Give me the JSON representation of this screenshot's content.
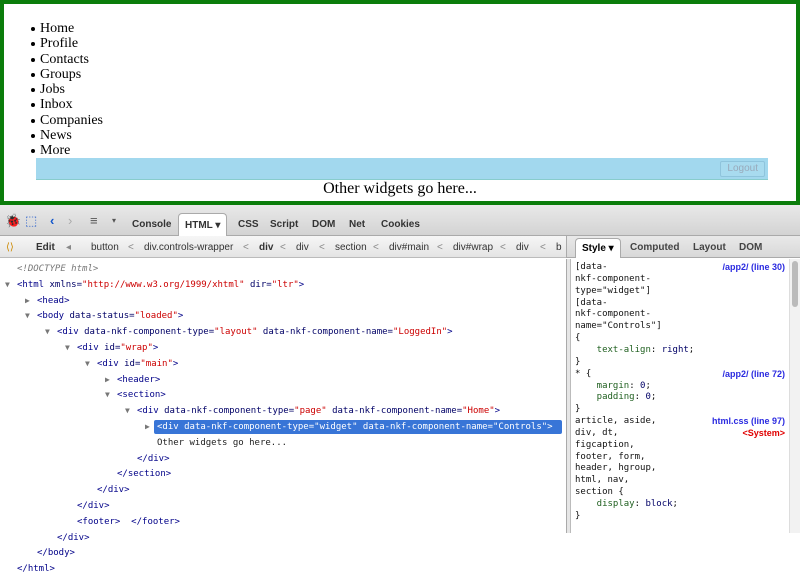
{
  "page": {
    "nav_items": [
      "Home",
      "Profile",
      "Contacts",
      "Groups",
      "Jobs",
      "Inbox",
      "Companies",
      "News",
      "More"
    ],
    "logout_label": "Logout",
    "other_widgets_text": "Other widgets go here...",
    "border_color": "#0b7d0b",
    "controls_bg": "#a2d8ee"
  },
  "devtools": {
    "tabs": [
      "Console",
      "HTML ▾",
      "CSS",
      "Script",
      "DOM",
      "Net",
      "Cookies"
    ],
    "active_tab": "HTML",
    "search_placeholder": "",
    "edit_label": "Edit",
    "breadcrumbs": [
      "button",
      "div.controls-wrapper",
      "div",
      "div",
      "section",
      "div#main",
      "div#wrap",
      "div",
      "b"
    ],
    "side_tabs": [
      "Style ▾",
      "Computed",
      "Layout",
      "DOM"
    ],
    "tree": [
      {
        "d": 0,
        "tw": "",
        "parts": [
          [
            "dt",
            "<!DOCTYPE html>"
          ]
        ]
      },
      {
        "d": 0,
        "tw": "open",
        "parts": [
          [
            "tag",
            "<html"
          ],
          [
            "an",
            " xmlns="
          ],
          [
            "av",
            "\"http://www.w3.org/1999/xhtml\""
          ],
          [
            "an",
            " dir="
          ],
          [
            "av",
            "\"ltr\""
          ],
          [
            "tag",
            ">"
          ]
        ]
      },
      {
        "d": 1,
        "tw": "closed",
        "parts": [
          [
            "tag",
            "<head>"
          ]
        ]
      },
      {
        "d": 1,
        "tw": "open",
        "parts": [
          [
            "tag",
            "<body"
          ],
          [
            "an",
            " data-status="
          ],
          [
            "av",
            "\"loaded\""
          ],
          [
            "tag",
            ">"
          ]
        ]
      },
      {
        "d": 2,
        "tw": "open",
        "parts": [
          [
            "tag",
            "<div"
          ],
          [
            "an",
            " data-nkf-component-type="
          ],
          [
            "av",
            "\"layout\""
          ],
          [
            "an",
            " data-nkf-component-name="
          ],
          [
            "av",
            "\"LoggedIn\""
          ],
          [
            "tag",
            ">"
          ]
        ]
      },
      {
        "d": 3,
        "tw": "open",
        "parts": [
          [
            "tag",
            "<div"
          ],
          [
            "an",
            " id="
          ],
          [
            "av",
            "\"wrap\""
          ],
          [
            "tag",
            ">"
          ]
        ]
      },
      {
        "d": 4,
        "tw": "open",
        "parts": [
          [
            "tag",
            "<div"
          ],
          [
            "an",
            " id="
          ],
          [
            "av",
            "\"main\""
          ],
          [
            "tag",
            ">"
          ]
        ]
      },
      {
        "d": 5,
        "tw": "closed",
        "parts": [
          [
            "tag",
            "<header>"
          ]
        ]
      },
      {
        "d": 5,
        "tw": "open",
        "parts": [
          [
            "tag",
            "<section>"
          ]
        ]
      },
      {
        "d": 6,
        "tw": "open",
        "parts": [
          [
            "tag",
            "<div"
          ],
          [
            "an",
            " data-nkf-component-type="
          ],
          [
            "av",
            "\"page\""
          ],
          [
            "an",
            " data-nkf-component-name="
          ],
          [
            "av",
            "\"Home\""
          ],
          [
            "tag",
            ">"
          ]
        ]
      },
      {
        "d": 7,
        "tw": "closed",
        "sel": true,
        "parts": [
          [
            "tag",
            "<div"
          ],
          [
            "an",
            " data-nkf-component-type="
          ],
          [
            "av",
            "\"widget\""
          ],
          [
            "an",
            " data-nkf-component-name="
          ],
          [
            "av",
            "\"Controls\""
          ],
          [
            "tag",
            ">"
          ]
        ]
      },
      {
        "d": 7,
        "tw": "",
        "parts": [
          [
            "txt",
            "Other widgets go here..."
          ]
        ]
      },
      {
        "d": 6,
        "tw": "",
        "parts": [
          [
            "tag",
            "</div>"
          ]
        ]
      },
      {
        "d": 5,
        "tw": "",
        "parts": [
          [
            "tag",
            "</section>"
          ]
        ]
      },
      {
        "d": 4,
        "tw": "",
        "parts": [
          [
            "tag",
            "</div>"
          ]
        ]
      },
      {
        "d": 3,
        "tw": "",
        "parts": [
          [
            "tag",
            "</div>"
          ]
        ]
      },
      {
        "d": 3,
        "tw": "",
        "parts": [
          [
            "tag",
            "<footer>  </footer>"
          ]
        ]
      },
      {
        "d": 2,
        "tw": "",
        "parts": [
          [
            "tag",
            "</div>"
          ]
        ]
      },
      {
        "d": 1,
        "tw": "",
        "parts": [
          [
            "tag",
            "</body>"
          ]
        ]
      },
      {
        "d": 0,
        "tw": "",
        "parts": [
          [
            "tag",
            "</html>"
          ]
        ]
      }
    ],
    "style_lines": [
      {
        "parts": [
          [
            "",
            "[data-"
          ]
        ],
        "src": "/app2/ (line 30)"
      },
      {
        "parts": [
          [
            "",
            "nkf-component-"
          ]
        ]
      },
      {
        "parts": [
          [
            "",
            "type=\"widget\"]"
          ]
        ]
      },
      {
        "parts": [
          [
            "",
            "[data-"
          ]
        ]
      },
      {
        "parts": [
          [
            "",
            "nkf-component-"
          ]
        ]
      },
      {
        "parts": [
          [
            "",
            "name=\"Controls\"]"
          ]
        ]
      },
      {
        "parts": [
          [
            "",
            "{"
          ]
        ]
      },
      {
        "parts": [
          [
            "prop",
            "    text-align"
          ],
          [
            "",
            ": "
          ],
          [
            "val",
            "right"
          ],
          [
            "",
            ";"
          ]
        ]
      },
      {
        "parts": [
          [
            "",
            "}"
          ]
        ]
      },
      {
        "parts": [
          [
            "",
            "* {"
          ]
        ],
        "src": "/app2/ (line 72)"
      },
      {
        "parts": [
          [
            "prop",
            "    margin"
          ],
          [
            "",
            ": "
          ],
          [
            "val",
            "0"
          ],
          [
            "",
            ";"
          ]
        ]
      },
      {
        "parts": [
          [
            "prop",
            "    padding"
          ],
          [
            "",
            ": "
          ],
          [
            "val",
            "0"
          ],
          [
            "",
            ";"
          ]
        ]
      },
      {
        "parts": [
          [
            "",
            "}"
          ]
        ]
      },
      {
        "parts": [
          [
            "",
            "article, aside,"
          ]
        ],
        "src": "html.css (line 97)"
      },
      {
        "parts": [
          [
            "",
            "div, dt,"
          ]
        ],
        "sys": "<System>"
      },
      {
        "parts": [
          [
            "",
            "figcaption,"
          ]
        ]
      },
      {
        "parts": [
          [
            "",
            "footer, form,"
          ]
        ]
      },
      {
        "parts": [
          [
            "",
            "header, hgroup,"
          ]
        ]
      },
      {
        "parts": [
          [
            "",
            "html, nav,"
          ]
        ]
      },
      {
        "parts": [
          [
            "",
            "section {"
          ]
        ]
      },
      {
        "parts": [
          [
            "prop",
            "    display"
          ],
          [
            "",
            ": "
          ],
          [
            "val",
            "block"
          ],
          [
            "",
            ";"
          ]
        ]
      },
      {
        "parts": [
          [
            "",
            "}"
          ]
        ]
      }
    ],
    "selection_color": "#3875d7"
  }
}
